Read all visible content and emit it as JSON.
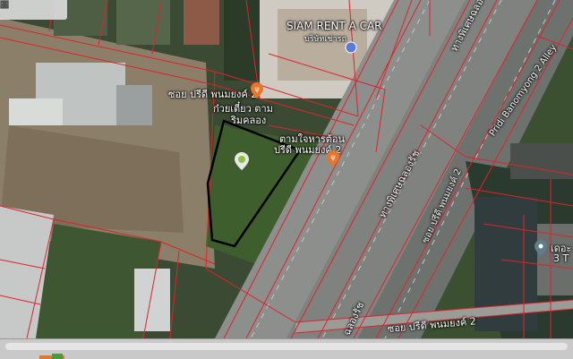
{
  "toolbar": {
    "tools": [
      "tool-square-icon",
      "tool-rect-icon",
      "tool-circle-icon",
      "tool-marker-icon",
      "tool-erase-icon"
    ]
  },
  "labels": {
    "alley_top_left": "ซอย ปรีดี พนมยงค์ 2",
    "poi_noodle": "ก๋วยเตี๋ยว ตาม",
    "poi_noodle_2": "ริมคลอง",
    "poi_restaurant": "ตามใจหารต้อน",
    "poi_restaurant_2": "ปรีดี พนมยงค์ 2",
    "siam_rent": "SIAM RENT A CAR",
    "siam_rent_th": "บริษัทเช่ารถ",
    "expressway_top": "ทางพิเศษฉลองรัช",
    "expressway_mid": "ทางพิเศษฉลองรัช",
    "pridi_alley_right": "Pridi Banomyong 2 Alley",
    "pridi_alley_vertical": "ซอย ปรีดี พนมยงค์ 2",
    "expressway_bottom": "ฉลองรัช",
    "alley_bottom": "ซอย ปรีดี พนมยงค์ 2",
    "bottom_right_poi": "เดอะ",
    "bottom_right_poi_2": "3 T"
  },
  "colors": {
    "parcel_line": "#e0222a",
    "boundary": "#000000",
    "poi_orange": "#e8752a",
    "marker_green": "#8ac43f"
  }
}
